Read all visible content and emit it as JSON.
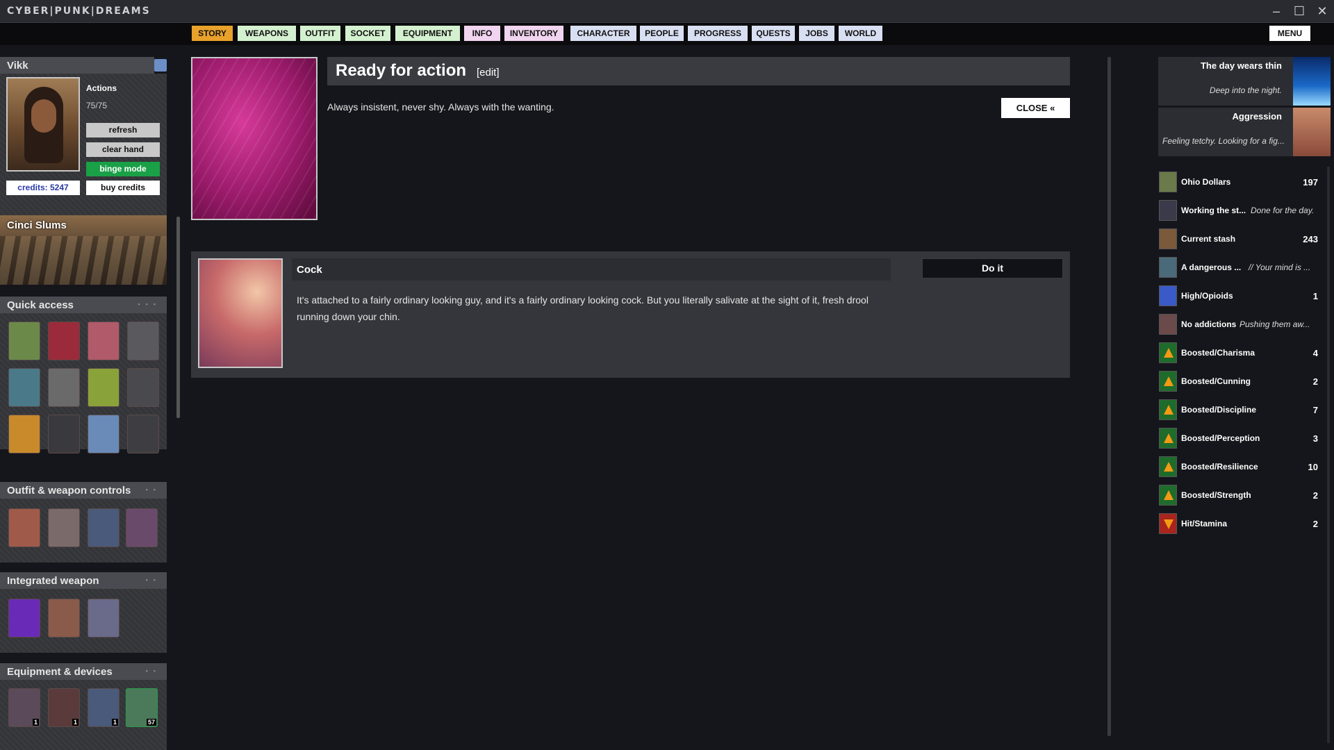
{
  "window": {
    "title": "CYBER|PUNK|DREAMS"
  },
  "nav": {
    "tabs": [
      "STORY",
      "WEAPONS",
      "OUTFIT",
      "SOCKET",
      "EQUIPMENT",
      "INFO",
      "INVENTORY",
      "CHARACTER",
      "PEOPLE",
      "PROGRESS",
      "QUESTS",
      "JOBS",
      "WORLD"
    ],
    "menu_label": "MENU"
  },
  "character": {
    "name": "Vikk",
    "actions_label": "Actions",
    "actions_value": "75/75",
    "refresh_label": "refresh",
    "clear_hand_label": "clear hand",
    "binge_mode_label": "binge mode",
    "credits_label": "credits: 5247",
    "buy_credits_label": "buy credits"
  },
  "location": {
    "name": "Cinci Slums"
  },
  "panels": {
    "quick_access": "Quick access",
    "outfit_weapon": "Outfit & weapon controls",
    "integrated_weapon": "Integrated weapon",
    "equipment": "Equipment & devices"
  },
  "equipment_counts": [
    "1",
    "1",
    "1",
    "57"
  ],
  "story": {
    "title": "Ready for action",
    "edit_label": "[edit]",
    "description": "Always insistent, never shy. Always with the wanting.",
    "close_label": "CLOSE «"
  },
  "action_card": {
    "title": "Cock",
    "text": "It's attached to a fairly ordinary looking guy, and it's a fairly ordinary looking cock. But you literally salivate at the sight of it, fresh drool running down your chin.",
    "button_label": "Do it"
  },
  "status_cards": [
    {
      "title": "The day wears thin",
      "subtitle": "Deep into the night."
    },
    {
      "title": "Aggression",
      "subtitle": "Feeling tetchy. Looking for a fig..."
    }
  ],
  "stats": [
    {
      "name": "Ohio Dollars",
      "desc": "",
      "value": "197",
      "icon": "cash-icon"
    },
    {
      "name": "Working the st...",
      "desc": "Done for the day.",
      "value": "",
      "icon": "street-icon"
    },
    {
      "name": "Current stash",
      "desc": "",
      "value": "243",
      "icon": "stash-icon"
    },
    {
      "name": "A dangerous ...",
      "desc": "// Your mind is ...",
      "value": "",
      "icon": "mind-icon"
    },
    {
      "name": "High/Opioids",
      "desc": "",
      "value": "1",
      "icon": "opioid-icon"
    },
    {
      "name": "No addictions",
      "desc": "Pushing them aw...",
      "value": "",
      "icon": "addiction-icon"
    },
    {
      "name": "Boosted/Charisma",
      "desc": "",
      "value": "4",
      "icon": "boost-arrow-icon"
    },
    {
      "name": "Boosted/Cunning",
      "desc": "",
      "value": "2",
      "icon": "boost-arrow-icon"
    },
    {
      "name": "Boosted/Discipline",
      "desc": "",
      "value": "7",
      "icon": "boost-arrow-icon"
    },
    {
      "name": "Boosted/Perception",
      "desc": "",
      "value": "3",
      "icon": "boost-arrow-icon"
    },
    {
      "name": "Boosted/Resilience",
      "desc": "",
      "value": "10",
      "icon": "boost-arrow-icon"
    },
    {
      "name": "Boosted/Strength",
      "desc": "",
      "value": "2",
      "icon": "boost-arrow-icon"
    },
    {
      "name": "Hit/Stamina",
      "desc": "",
      "value": "2",
      "icon": "hit-arrow-icon"
    }
  ]
}
